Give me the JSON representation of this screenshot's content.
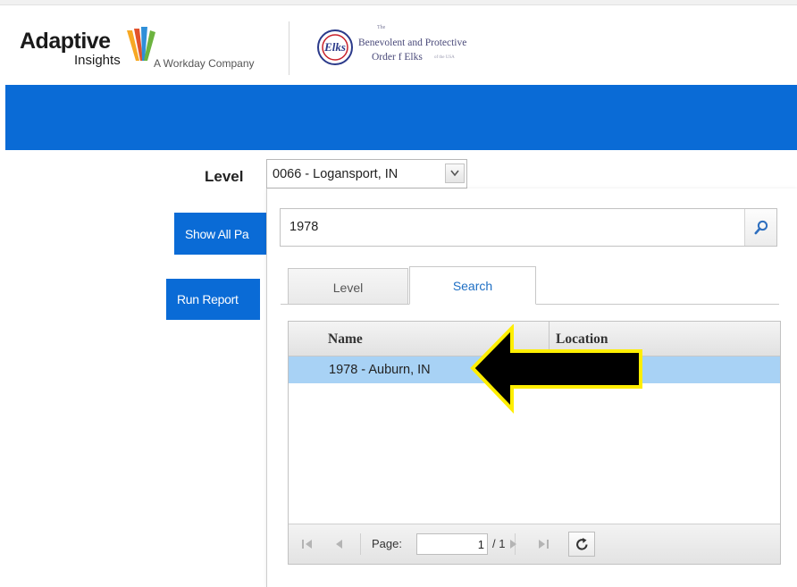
{
  "header": {
    "brand_name": "Adaptive",
    "brand_sub": "Insights",
    "brand_tagline": "A Workday Company",
    "partner_small": "The",
    "partner_line1": "Benevolent and Protective",
    "partner_line2": "Order f Elks",
    "partner_tiny": "of the USA",
    "partner_logo_text": "Elks",
    "brand_color": "#0a6bd6"
  },
  "form": {
    "level_label": "Level",
    "level_value": "0066 - Logansport, IN",
    "show_all_label": "Show All Pa",
    "run_report_label": "Run Report"
  },
  "dropdown": {
    "search_value": "1978",
    "tabs": [
      {
        "label": "Level",
        "active": false
      },
      {
        "label": "Search",
        "active": true
      }
    ],
    "columns": [
      "Name",
      "Location"
    ],
    "rows": [
      {
        "name": "1978 - Auburn, IN",
        "location": "",
        "selected": true
      }
    ],
    "pager": {
      "page_label": "Page:",
      "page_value": "1",
      "page_total": "/ 1"
    }
  },
  "annotation": {
    "arrow_fill": "#000000",
    "arrow_stroke": "#ffee00",
    "selected_row_color": "#a8d2f5"
  }
}
